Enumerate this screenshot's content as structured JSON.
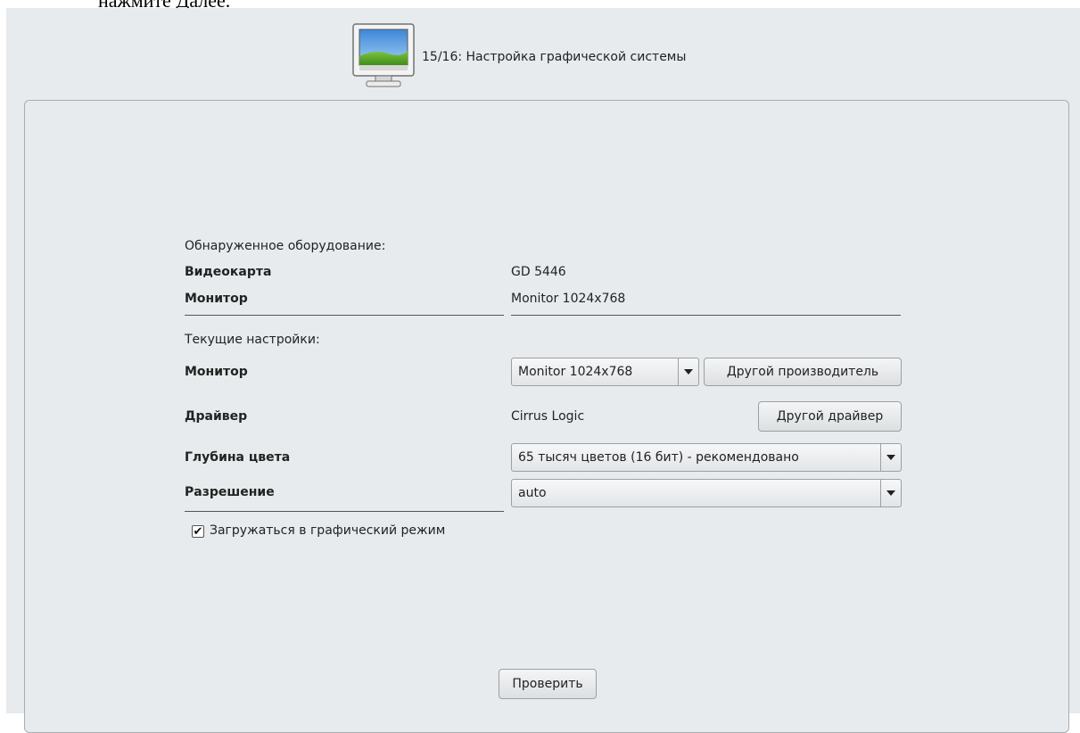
{
  "doc_text": "нажмите Далее.",
  "header": {
    "title": "15/16: Настройка графической системы"
  },
  "detected": {
    "heading": "Обнаруженное оборудование:",
    "video_card": {
      "label": "Видеокарта",
      "value": "GD 5446"
    },
    "monitor": {
      "label": "Монитор",
      "value": "Monitor 1024x768"
    }
  },
  "current": {
    "heading": "Текущие настройки:",
    "monitor": {
      "label": "Монитор",
      "selected": "Monitor 1024x768",
      "other_button": "Другой производитель"
    },
    "driver": {
      "label": "Драйвер",
      "value": "Cirrus Logic",
      "other_button": "Другой драйвер"
    },
    "color_depth": {
      "label": "Глубина цвета",
      "selected": "65 тысяч цветов (16 бит) - рекомендовано"
    },
    "resolution": {
      "label": "Разрешение",
      "selected": "auto"
    }
  },
  "boot_graphical": {
    "label": "Загружаться в графический режим",
    "checked": true,
    "check_glyph": "✔"
  },
  "test_button": "Проверить"
}
